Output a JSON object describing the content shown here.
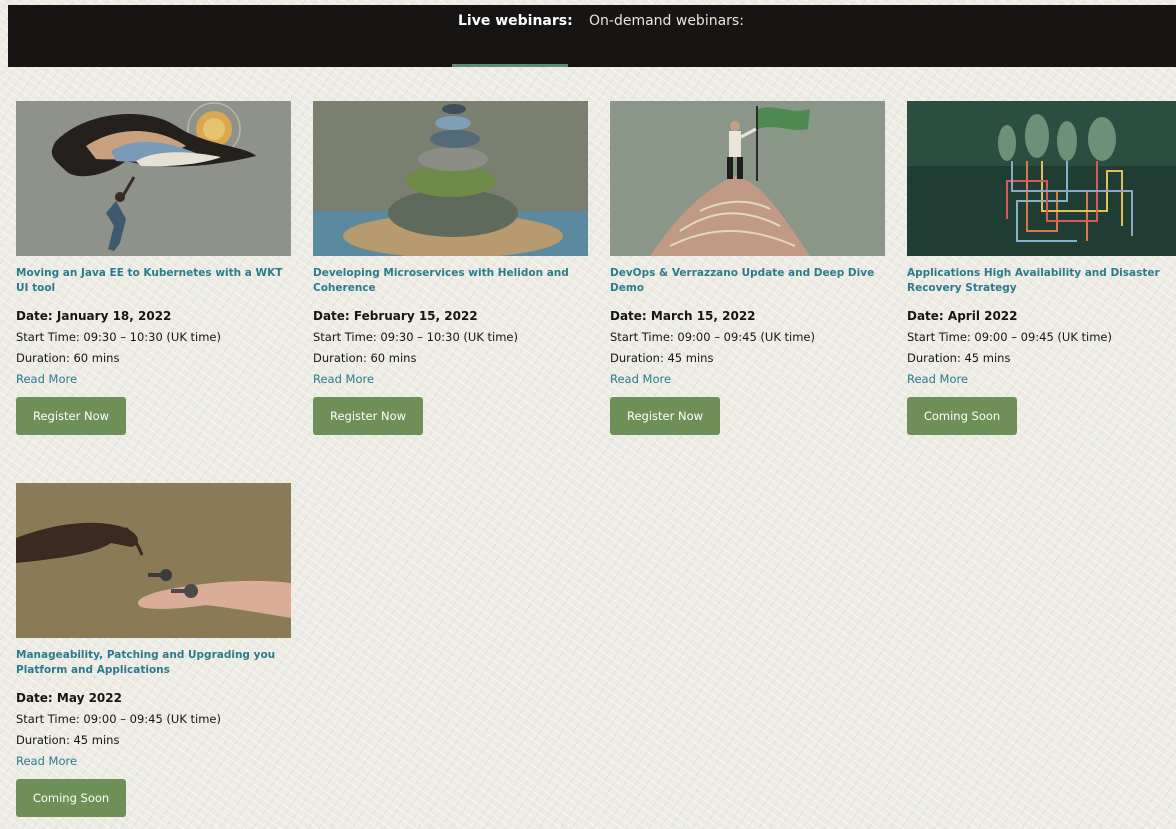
{
  "tabs": [
    {
      "label": "Live webinars:",
      "active": true
    },
    {
      "label": "On-demand webinars:",
      "active": false
    }
  ],
  "colors": {
    "topbar": "#161513",
    "title_link": "#2c7a8e",
    "button": "#6f8f58",
    "tab_underline": "#5e8a72"
  },
  "webinars": [
    {
      "title": "Moving an Java EE to Kubernetes with a WKT UI tool",
      "date": "Date: January 18, 2022",
      "start_time": "Start Time: 09:30 – 10:30 (UK time)",
      "duration": "Duration: 60 mins",
      "read_more": "Read More",
      "button": "Register Now",
      "image": "illustration-woman-reaching-for-floating-shape"
    },
    {
      "title": "Developing Microservices with Helidon and Coherence",
      "date": "Date: February 15, 2022",
      "start_time": "Start Time: 09:30 – 10:30 (UK time)",
      "duration": "Duration: 60 mins",
      "read_more": "Read More",
      "button": "Register Now",
      "image": "illustration-stacked-stones"
    },
    {
      "title": "DevOps & Verrazzano Update and Deep Dive Demo",
      "date": "Date: March 15, 2022",
      "start_time": "Start Time: 09:00 – 09:45 (UK time)",
      "duration": "Duration: 45 mins",
      "read_more": "Read More",
      "button": "Register Now",
      "image": "illustration-man-with-flag-on-mountain"
    },
    {
      "title": "Applications High Availability and Disaster Recovery Strategy",
      "date": "Date: April 2022",
      "start_time": "Start Time: 09:00 – 09:45 (UK time)",
      "duration": "Duration: 45 mins",
      "read_more": "Read More",
      "button": "Coming Soon",
      "image": "illustration-trees-with-root-network"
    },
    {
      "title": "Manageability, Patching and Upgrading you Platform and Applications",
      "date": "Date: May 2022",
      "start_time": "Start Time: 09:00 – 09:45 (UK time)",
      "duration": "Duration: 45 mins",
      "read_more": "Read More",
      "button": "Coming Soon",
      "image": "illustration-hands-passing-key"
    }
  ]
}
